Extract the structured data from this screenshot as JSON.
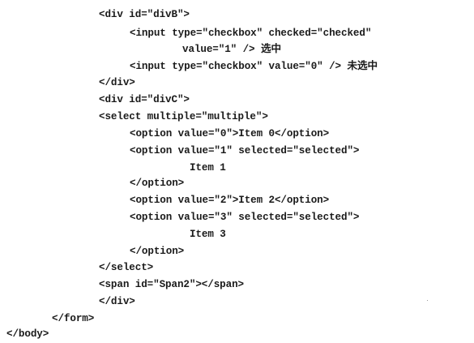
{
  "code": {
    "lines": [
      "<div id=\"divB\">",
      "<input type=\"checkbox\" checked=\"checked\"",
      "value=\"1\" /> 选中",
      "<input type=\"checkbox\" value=\"0\" /> 未选中",
      "</div>",
      "<div id=\"divC\">",
      "<select multiple=\"multiple\">",
      "<option value=\"0\">Item 0</option>",
      "<option value=\"1\" selected=\"selected\">",
      "Item 1",
      "</option>",
      "<option value=\"2\">Item 2</option>",
      "<option value=\"3\" selected=\"selected\">",
      "Item 3",
      "</option>",
      "</select>",
      "<span id=\"Span2\"></span>",
      "</div>",
      "</form>",
      "</body>"
    ]
  }
}
